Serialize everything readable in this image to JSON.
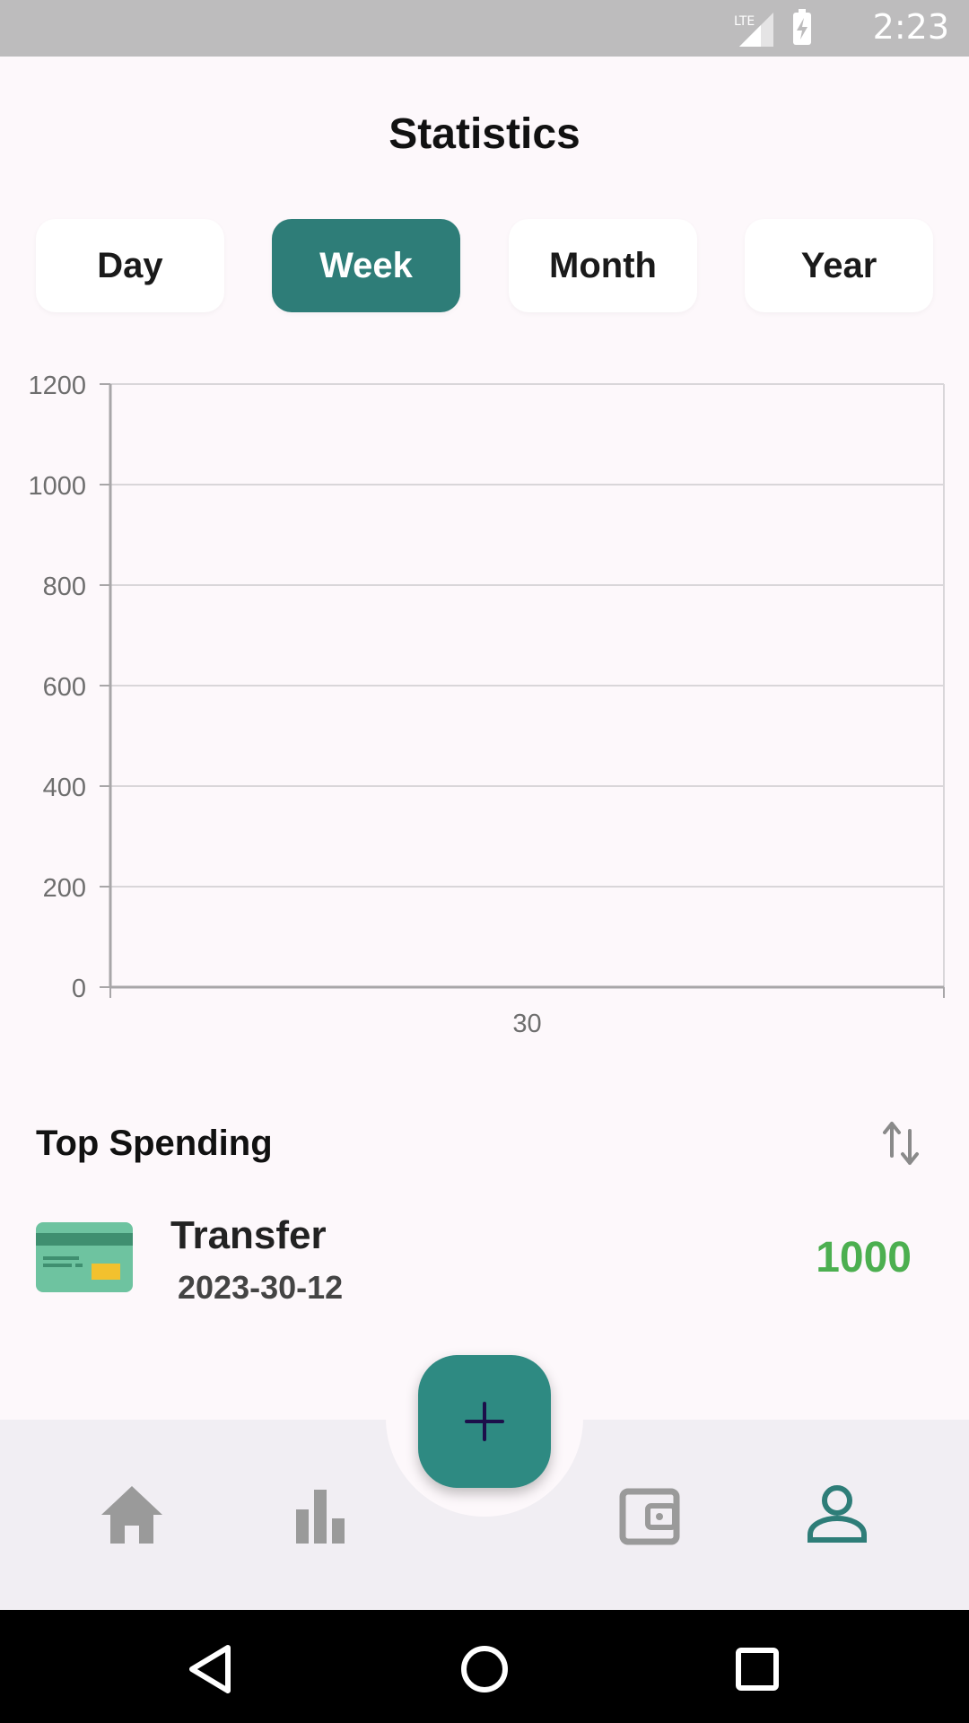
{
  "status_bar": {
    "time": "2:23",
    "network": "LTE"
  },
  "screen_title": "Statistics",
  "period_tabs": [
    {
      "label": "Day",
      "active": false
    },
    {
      "label": "Week",
      "active": true
    },
    {
      "label": "Month",
      "active": false
    },
    {
      "label": "Year",
      "active": false
    }
  ],
  "chart_data": {
    "type": "bar",
    "categories": [
      "30"
    ],
    "values": [
      0
    ],
    "ylim": [
      0,
      1200
    ],
    "y_ticks": [
      "0",
      "200",
      "400",
      "600",
      "800",
      "1000",
      "1200"
    ],
    "grid": true
  },
  "top_spending": {
    "title": "Top Spending",
    "items": [
      {
        "name": "Transfer",
        "date": "2023-30-12",
        "amount": "1000",
        "icon": "credit-card-icon"
      }
    ]
  },
  "fab": {
    "label": "+"
  },
  "bottom_nav": [
    {
      "icon": "home-icon",
      "active": false
    },
    {
      "icon": "bar-chart-icon",
      "active": false
    },
    {
      "icon": "wallet-icon",
      "active": false
    },
    {
      "icon": "person-icon",
      "active": true
    }
  ],
  "colors": {
    "accent": "#2e7d78",
    "fab": "#2e8a82",
    "positive_amount": "#4caf50",
    "background": "#fdf8fb",
    "nav_background": "#f1eef3",
    "inactive_icon": "#9a9a9a"
  }
}
